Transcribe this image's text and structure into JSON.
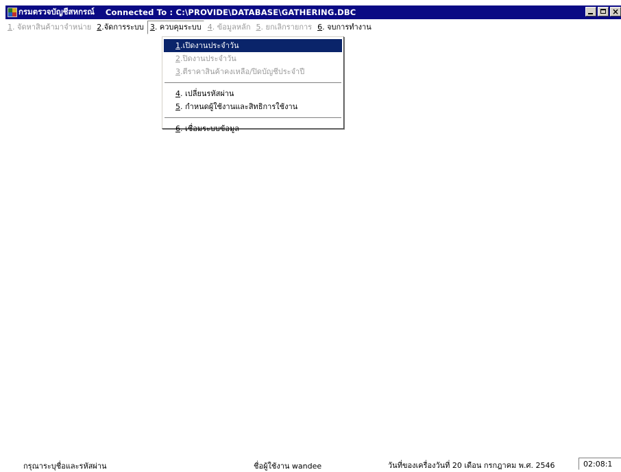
{
  "titlebar": {
    "app_name": "กรมตรวจบัญชีสหกรณ์",
    "connection": "Connected  To  :  C:\\PROVIDE\\DATABASE\\GATHERING.DBC",
    "minimize_icon": "minimize-icon",
    "maximize_icon": "maximize-icon",
    "close_icon": "close-icon"
  },
  "menubar": {
    "items": [
      {
        "key": "1",
        "label": ". จัดหาสินค้ามาจำหน่าย",
        "enabled": false
      },
      {
        "key": "2",
        "label": ".จัดการระบบ",
        "enabled": true
      },
      {
        "key": "3",
        "label": ". ควบคุมระบบ",
        "enabled": true,
        "open": true
      },
      {
        "key": "4",
        "label": ". ข้อมูลหลัก",
        "enabled": false
      },
      {
        "key": "5",
        "label": ". ยกเลิกรายการ",
        "enabled": false
      },
      {
        "key": "6",
        "label": ". จบการทำงาน",
        "enabled": true
      }
    ]
  },
  "dropdown": {
    "group1": [
      {
        "key": "1",
        "label": ".เปิดงานประจำวัน",
        "selected": true,
        "enabled": true
      },
      {
        "key": "2",
        "label": ".ปิดงานประจำวัน",
        "enabled": false
      },
      {
        "key": "3",
        "label": ".ตีราคาสินค้าคงเหลือ/ปิดบัญชีประจำปี",
        "enabled": false
      }
    ],
    "group2": [
      {
        "key": "4",
        "label": ". เปลี่ยนรหัสผ่าน",
        "enabled": true
      },
      {
        "key": "5",
        "label": ". กำหนดผู้ใช้งานและสิทธิการใช้งาน",
        "enabled": true
      }
    ],
    "group3": [
      {
        "key": "6",
        "label": ". เชื่อมระบบข้อมูล",
        "enabled": true
      }
    ]
  },
  "statusbar": {
    "message": "กรุณาระบุชื่อและรหัสผ่าน",
    "user": "ชื่อผู้ใช้งาน wandee",
    "date": "วันที่ของเครื่องวันที่ 20 เดือน กรกฎาคม  พ.ศ. 2546",
    "clock": "02:08:1"
  },
  "colors": {
    "titlebar_bg": "#0a0a84",
    "selection_bg": "#0a246a",
    "disabled_text": "#9a9a9a"
  }
}
